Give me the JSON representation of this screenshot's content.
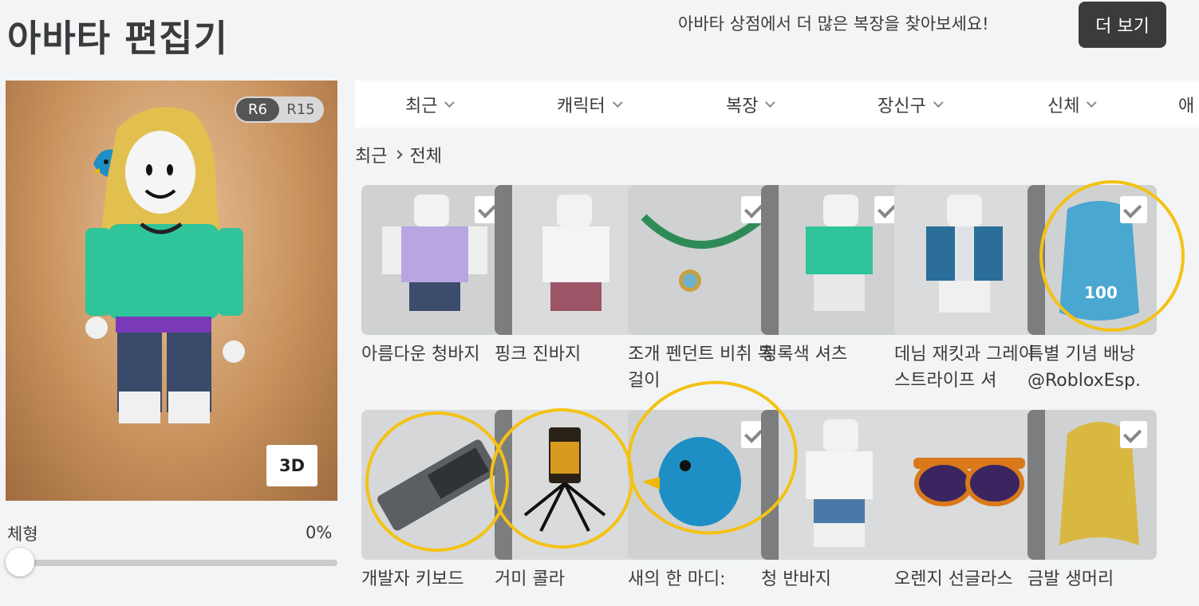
{
  "header": {
    "title": "아바타 편집기",
    "promo_text": "아바타 상점에서 더 많은 복장을 찾아보세요!",
    "more_button_label": "더 보기"
  },
  "preview": {
    "rig_options": [
      "R6",
      "R15"
    ],
    "selected_rig": "R6",
    "view_3d_label": "3D"
  },
  "body_type": {
    "label": "체형",
    "value": "0%",
    "level": 0
  },
  "tabs": [
    {
      "label": "최근"
    },
    {
      "label": "캐릭터"
    },
    {
      "label": "복장"
    },
    {
      "label": "장신구"
    },
    {
      "label": "신체"
    },
    {
      "label": "애"
    }
  ],
  "breadcrumb": {
    "parent": "최근",
    "current": "전체"
  },
  "items": [
    {
      "name": "아름다운 청바지",
      "thumb": "jeans-outfit-thumb",
      "checked": true,
      "highlighted": false
    },
    {
      "name": "핑크 진바지",
      "thumb": "pink-jeans-thumb",
      "checked": false,
      "highlighted": false
    },
    {
      "name": "조개 펜던트 비취 목걸이",
      "thumb": "jade-necklace-thumb",
      "checked": true,
      "highlighted": false
    },
    {
      "name": "청록색 셔츠",
      "thumb": "teal-shirt-thumb",
      "checked": true,
      "highlighted": false
    },
    {
      "name": "데님 재킷과 그레이 스트라이프 셔",
      "thumb": "denim-jacket-thumb",
      "checked": false,
      "highlighted": false
    },
    {
      "name": "특별 기념 배낭",
      "creator": "@RobloxEsp.",
      "thumb": "backpack-thumb",
      "checked": true,
      "highlighted": true
    },
    {
      "name": "개발자 키보드",
      "thumb": "keyboard-thumb",
      "checked": false,
      "highlighted": true
    },
    {
      "name": "거미 콜라",
      "thumb": "spider-cola-thumb",
      "checked": false,
      "highlighted": true
    },
    {
      "name": "새의 한 마디:",
      "thumb": "blue-bird-thumb",
      "checked": true,
      "highlighted": true
    },
    {
      "name": "청 반바지",
      "thumb": "shorts-thumb",
      "checked": false,
      "highlighted": false
    },
    {
      "name": "오렌지 선글라스",
      "thumb": "sunglasses-thumb",
      "checked": false,
      "highlighted": false
    },
    {
      "name": "금발 생머리",
      "thumb": "blonde-hair-thumb",
      "checked": true,
      "highlighted": false
    }
  ],
  "colors": {
    "accent_dark": "#393b3d",
    "annotation": "#f4c214",
    "tile_bg": "#d0d1d2"
  }
}
